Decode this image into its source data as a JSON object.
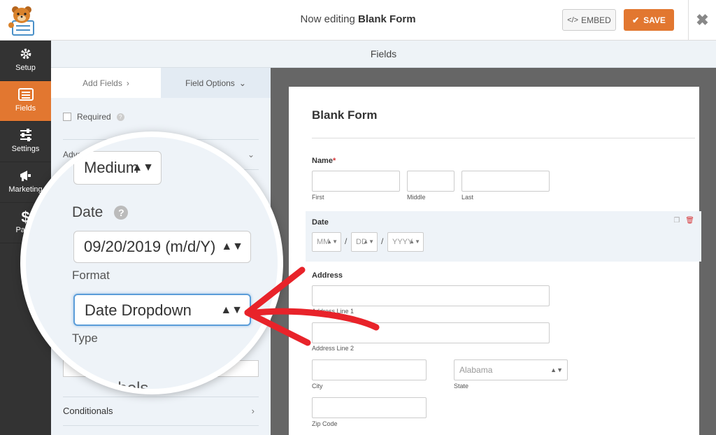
{
  "header": {
    "title_prefix": "Now editing",
    "title_form": "Blank Form",
    "embed_label": "EMBED",
    "save_label": "SAVE",
    "close_glyph": "✖"
  },
  "nav": {
    "items": [
      {
        "label": "Setup",
        "icon": "gear-icon"
      },
      {
        "label": "Fields",
        "icon": "list-icon",
        "active": true
      },
      {
        "label": "Settings",
        "icon": "sliders-icon"
      },
      {
        "label": "Marketing",
        "icon": "megaphone-icon"
      },
      {
        "label": "Paym",
        "icon": "dollar-icon"
      }
    ]
  },
  "fields_bar": {
    "title": "Fields"
  },
  "panel": {
    "tab_add": "Add Fields",
    "tab_options": "Field Options",
    "required_label": "Required",
    "advanced_label": "Adva",
    "conditionals_label": "Conditionals"
  },
  "magnifier": {
    "size_value": "Medium",
    "date_label": "Date",
    "format_value": "09/20/2019 (m/d/Y)",
    "format_label": "Format",
    "type_value": "Date Dropdown",
    "type_label": "Type",
    "cut_text": "...ide Labels"
  },
  "form": {
    "title": "Blank Form",
    "name_label": "Name",
    "required_mark": "*",
    "name_first": "First",
    "name_middle": "Middle",
    "name_last": "Last",
    "date_label": "Date",
    "date_mm": "MM",
    "date_dd": "DD",
    "date_yyyy": "YYYY",
    "date_sep": "/",
    "address_label": "Address",
    "address_line1": "Address Line 1",
    "address_line2": "Address Line 2",
    "city": "City",
    "state": "State",
    "state_value": "Alabama",
    "zip": "Zip Code"
  },
  "colors": {
    "accent": "#e27730",
    "nav_bg": "#333333",
    "arrow_red": "#e8232a",
    "focus_blue": "#5b9dd9"
  }
}
